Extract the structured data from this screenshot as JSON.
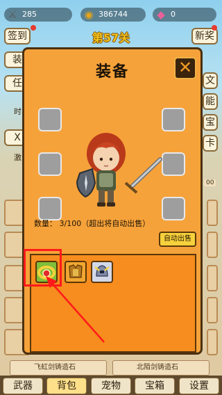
{
  "resources": {
    "swords": {
      "value": "285",
      "icon": "crossed-swords-icon"
    },
    "coins": {
      "value": "386744",
      "icon": "coin-stack-icon"
    },
    "gems": {
      "value": "0",
      "icon": "pink-gem-icon"
    }
  },
  "level_title": "第57关",
  "left_buttons": [
    "签到",
    "装",
    "任",
    "时",
    "X",
    "激"
  ],
  "right_buttons": [
    "新奖",
    "文",
    "能",
    "宝",
    "卡"
  ],
  "dialog": {
    "title": "装备",
    "count_label": "数量：",
    "count_value": "3/100（超出将自动出售）",
    "auto_sell_label": "自动出售",
    "inventory": [
      {
        "name": "red-gem-ring",
        "icon": "ring-icon"
      },
      {
        "name": "golden-armor",
        "icon": "armor-icon"
      },
      {
        "name": "silver-helmet",
        "icon": "helmet-icon"
      }
    ]
  },
  "side_value": "00",
  "background_items": [
    "飞虹剑铸造石",
    "北陌剑铸造石"
  ],
  "tabs": [
    "武器",
    "背包",
    "宠物",
    "宝箱",
    "设置"
  ],
  "active_tab": "背包",
  "colors": {
    "dialog_bg": "#f6a23a",
    "inventory_bg": "#f68d1e",
    "highlight": "#ff1a1a",
    "level_gold": "#f4c21b"
  }
}
